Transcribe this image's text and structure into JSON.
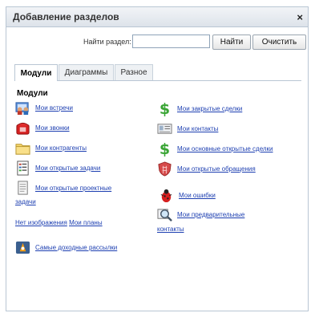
{
  "dialog": {
    "title": "Добавление разделов",
    "close_glyph": "×"
  },
  "search": {
    "label": "Найти раздел:",
    "value": "",
    "placeholder": "",
    "find_label": "Найти",
    "clear_label": "Очистить"
  },
  "tabs": [
    {
      "label": "Модули",
      "active": true
    },
    {
      "label": "Диаграммы",
      "active": false
    },
    {
      "label": "Разное",
      "active": false
    }
  ],
  "section": {
    "title": "Модули"
  },
  "left_items": [
    {
      "label": "Мои встречи",
      "icon": "meeting-icon"
    },
    {
      "label": "Мои звонки",
      "icon": "phone-icon"
    },
    {
      "label": "Мои контрагенты",
      "icon": "folder-icon"
    },
    {
      "label": "Мои открытые задачи",
      "icon": "tasks-icon"
    },
    {
      "label_line1": "Мои открытые проектные",
      "label_line2": "задачи",
      "icon": "document-icon"
    },
    {
      "label_prefix": "Нет изображения",
      "label": "Мои планы",
      "icon": "none"
    },
    {
      "label": "Самые доходные рассылки",
      "icon": "campaign-icon"
    }
  ],
  "right_items": [
    {
      "label": "Мои закрытые сделки",
      "icon": "dollar-icon"
    },
    {
      "label": "Мои контакты",
      "icon": "contact-card-icon"
    },
    {
      "label": "Мои основные открытые сделки",
      "icon": "dollar-icon"
    },
    {
      "label": "Мои открытые обращения",
      "icon": "shield-icon"
    },
    {
      "label": "Мои ошибки",
      "icon": "bug-icon"
    },
    {
      "label_line1": "Мои предварительные",
      "label_line2": "контакты",
      "icon": "magnifier-icon"
    }
  ],
  "colors": {
    "link": "#1d3fb1",
    "dollar": "#3aa535",
    "border": "#b9c6d4"
  }
}
